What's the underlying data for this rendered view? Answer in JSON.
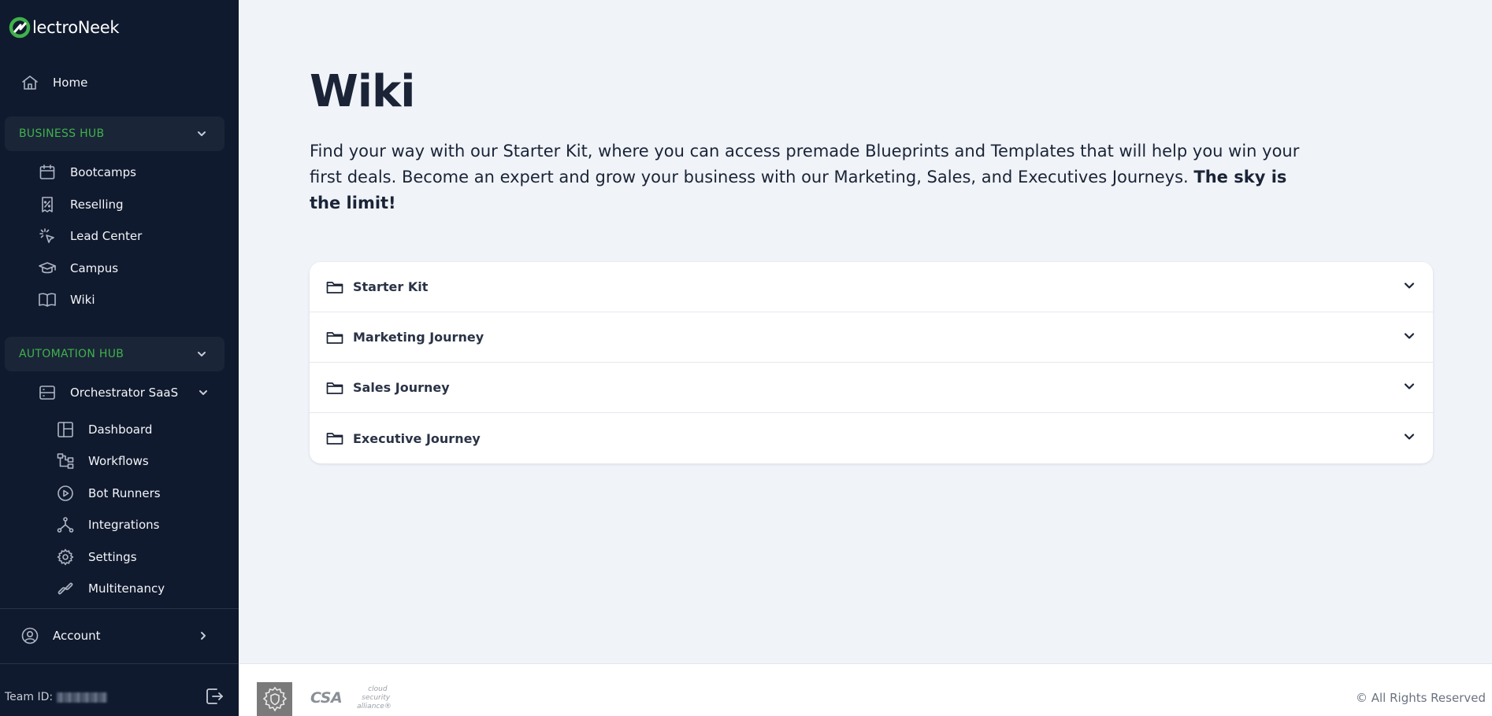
{
  "app": {
    "logo_text": "lectroNeek",
    "brand_color": "#3fb24a",
    "sidebar_bg": "#101a2e"
  },
  "sidebar": {
    "home_label": "Home",
    "business_hub": {
      "title": "BUSINESS HUB",
      "items": [
        {
          "label": "Bootcamps",
          "icon": "calendar-icon"
        },
        {
          "label": "Reselling",
          "icon": "receipt-percent-icon"
        },
        {
          "label": "Lead Center",
          "icon": "cursor-click-icon"
        },
        {
          "label": "Campus",
          "icon": "graduation-cap-icon"
        },
        {
          "label": "Wiki",
          "icon": "book-open-icon"
        }
      ]
    },
    "automation_hub": {
      "title": "AUTOMATION HUB",
      "orchestrator": {
        "label": "Orchestrator SaaS",
        "icon": "server-icon"
      },
      "items": [
        {
          "label": "Dashboard",
          "icon": "layout-icon"
        },
        {
          "label": "Workflows",
          "icon": "workflow-icon"
        },
        {
          "label": "Bot Runners",
          "icon": "play-circle-icon"
        },
        {
          "label": "Integrations",
          "icon": "nodes-icon"
        },
        {
          "label": "Settings",
          "icon": "gear-icon"
        },
        {
          "label": "Multitenancy",
          "icon": "link-icon"
        }
      ]
    },
    "account_label": "Account",
    "team_id_label": "Team ID:"
  },
  "main": {
    "title": "Wiki",
    "description": "Find your way with our Starter Kit, where you can access premade Blueprints and Templates that will help you win your first deals. Become an expert and grow your business with our Marketing, Sales, and Executives Journeys.",
    "description_bold": "The sky is the limit!",
    "sections": [
      {
        "label": "Starter Kit",
        "icon": "folder-icon"
      },
      {
        "label": "Marketing Journey",
        "icon": "folder-icon"
      },
      {
        "label": "Sales Journey",
        "icon": "folder-icon"
      },
      {
        "label": "Executive Journey",
        "icon": "folder-icon"
      }
    ]
  },
  "footer": {
    "csa_mark": "CSA",
    "csa_sub": [
      "cloud",
      "security",
      "alliance®"
    ],
    "rights": "© All Rights Reserved"
  }
}
